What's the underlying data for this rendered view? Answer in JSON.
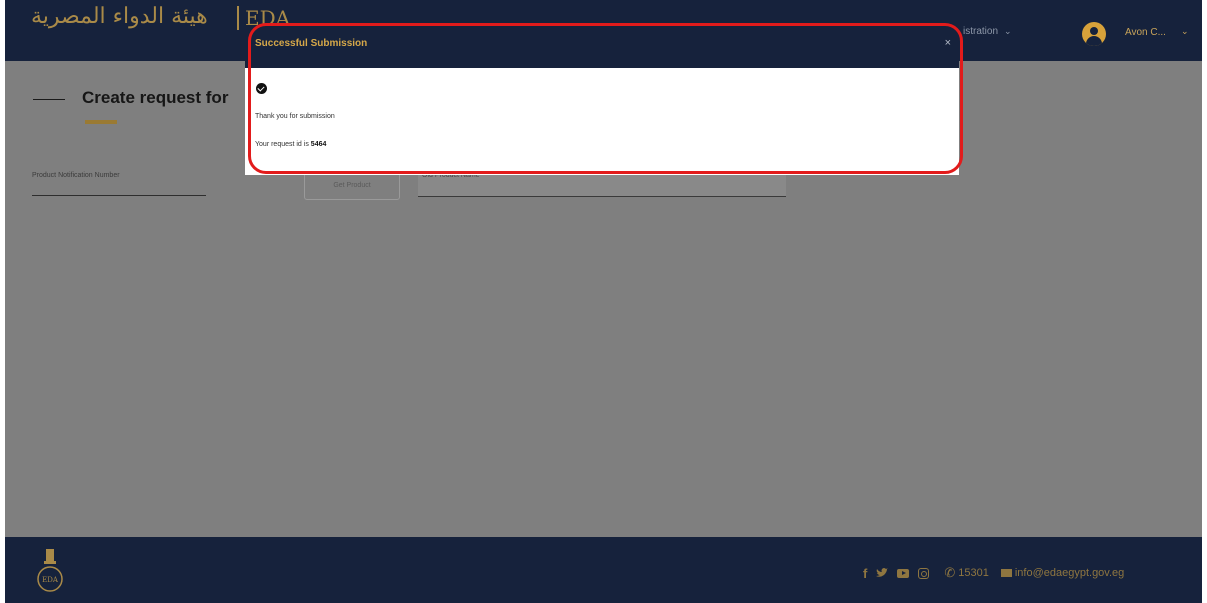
{
  "header": {
    "logo_arabic": "هيئة الدواء المصرية",
    "logo_latin": "EDA",
    "nav_item": "istration",
    "user_name": "Avon C..."
  },
  "page": {
    "title": "Create request for",
    "field_label": "Product Notification Number",
    "get_product_button": "Get Product",
    "product_field_label": "Old Product Name"
  },
  "modal": {
    "title": "Successful Submission",
    "close": "×",
    "message": "Thank you for submission",
    "request_prefix": "Your request id is",
    "request_id": "5464"
  },
  "footer": {
    "facebook": "f",
    "phone": "15301",
    "email": "info@edaegypt.gov.eg"
  },
  "colors": {
    "navy": "#16223c",
    "gold": "#d6a849",
    "highlight": "#e21b1b"
  },
  "icons": [
    "facebook-icon",
    "twitter-icon",
    "youtube-icon",
    "instagram-icon",
    "phone-icon",
    "mail-icon",
    "check-circle-icon",
    "user-avatar-icon"
  ]
}
